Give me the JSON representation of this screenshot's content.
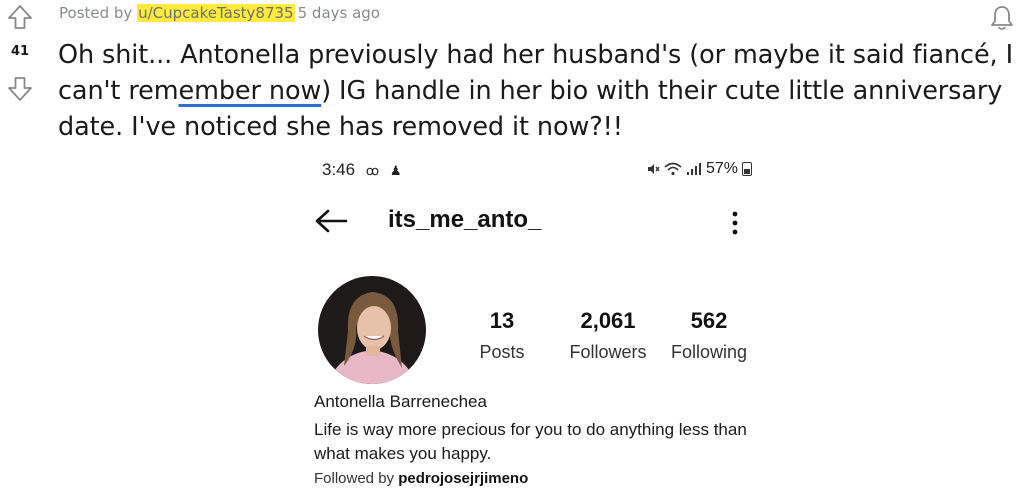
{
  "post": {
    "score": "41",
    "posted_by_prefix": "Posted by",
    "username": "u/CupcakeTasty8735",
    "age": "5 days ago",
    "title_part1": "Oh shit... Antonella previously had her husband's (or maybe it said fiancé, I can't rem",
    "title_underlined": "ember now",
    "title_part2": ") IG handle in her bio with their cute little anniversary date. I've noticed she has removed it now?!!"
  },
  "icons": {
    "upvote": "arrow-up-icon",
    "downvote": "arrow-down-icon",
    "notify": "bell-icon"
  },
  "screenshot": {
    "time": "3:46",
    "battery": "57%",
    "handle": "its_me_anto_",
    "stats": [
      {
        "num": "13",
        "label": "Posts"
      },
      {
        "num": "2,061",
        "label": "Followers"
      },
      {
        "num": "562",
        "label": "Following"
      }
    ],
    "name": "Antonella Barrenechea",
    "bio": "Life is way more precious for you to do anything less than what makes you happy.",
    "followed_by_prefix": "Followed by",
    "followed_by_user": "pedrojosejrjimeno"
  },
  "colors": {
    "highlight": "#ffeb3b",
    "spellcheck_underline": "#2d6fd6",
    "text": "#1a1a1b",
    "muted": "#878a8c"
  }
}
